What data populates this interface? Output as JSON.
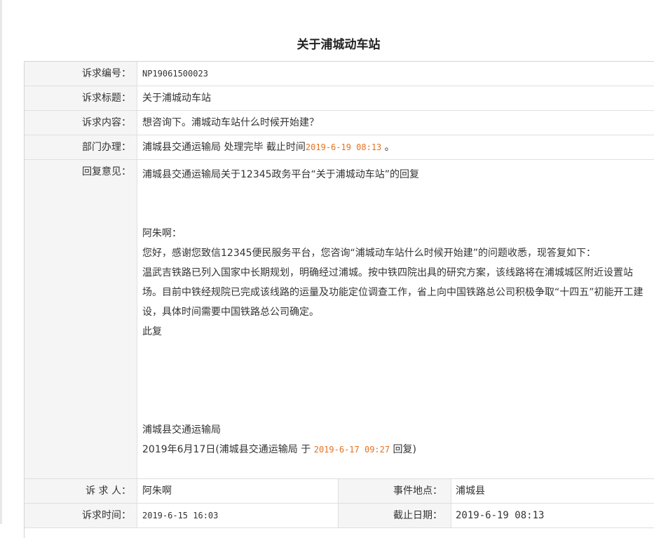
{
  "page": {
    "title": "关于浦城动车站"
  },
  "complaint": {
    "id_label": "诉求编号：",
    "id_value": "NP19061500023",
    "title_label": "诉求标题：",
    "title_value": "关于浦城动车站",
    "content_label": "诉求内容：",
    "content_value": "想咨询下。浦城动车站什么时候开始建？"
  },
  "department": {
    "label": "部门办理：",
    "text": "浦城县交通运输局 处理完毕 截止时间",
    "deadline": "2019-6-19 08:13",
    "suffix": " 。"
  },
  "reply": {
    "label": "回复意见：",
    "heading": "浦城县交通运输局关于12345政务平台“关于浦城动车站”的回复",
    "salutation": "阿朱啊：",
    "para1": "您好，感谢您致信12345便民服务平台，您咨询“浦城动车站什么时候开始建”的问题收悉，现答复如下：",
    "para2": "温武吉铁路已列入国家中长期规划，明确经过浦城。按中铁四院出具的研究方案，该线路将在浦城城区附近设置站场。目前中铁经规院已完成该线路的运量及功能定位调查工作，省上向中国铁路总公司积极争取“十四五”初能开工建设，具体时间需要中国铁路总公司确定。",
    "closing": "此复",
    "signature": "浦城县交通运输局",
    "date_prefix": "2019年6月17日(浦城县交通运输局 于 ",
    "date_time": "2019-6-17 09:27",
    "date_suffix": " 回复)"
  },
  "meta": {
    "requester_label": "诉 求 人：",
    "requester_value": "阿朱啊",
    "location_label": "事件地点：",
    "location_value": "浦城县",
    "time_label": "诉求时间：",
    "time_value": "2019-6-15 16:03",
    "deadline_label": "截止日期：",
    "deadline_value": "2019-6-19 08:13"
  }
}
